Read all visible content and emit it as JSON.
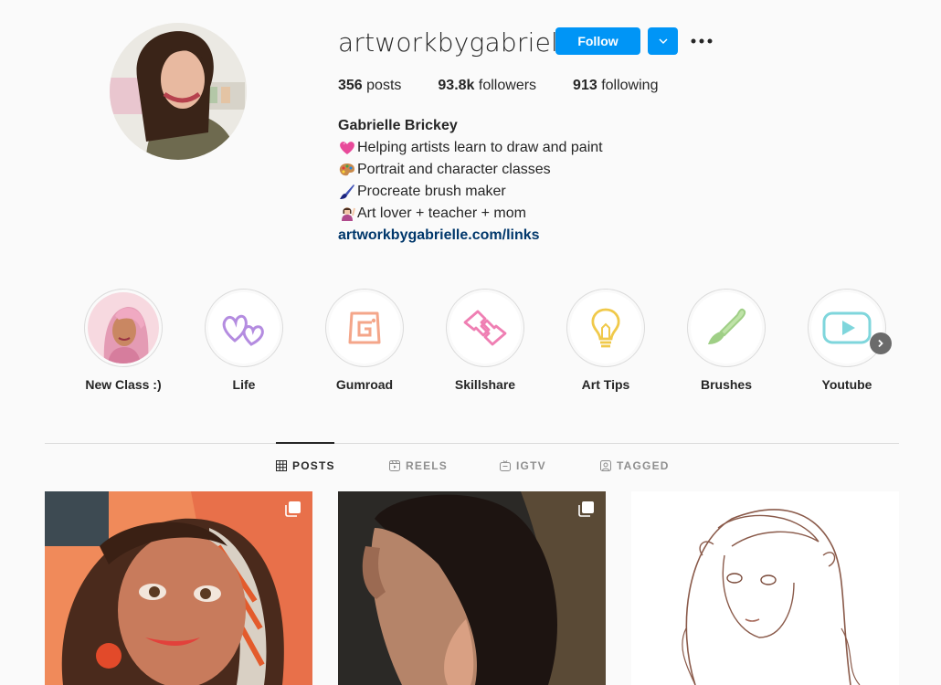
{
  "profile": {
    "username": "artworkbygabrielle",
    "follow_label": "Follow",
    "stats": {
      "posts_count": "356",
      "posts_label": "posts",
      "followers_count": "93.8k",
      "followers_label": "followers",
      "following_count": "913",
      "following_label": "following"
    },
    "full_name": "Gabrielle Brickey",
    "bio_lines": [
      "Helping artists learn to draw and paint",
      "Portrait and character classes",
      "Procreate brush maker",
      "Art lover + teacher + mom"
    ],
    "link": "artworkbygabrielle.com/links"
  },
  "highlights": [
    {
      "label": "New Class :)",
      "icon": "woman-portrait"
    },
    {
      "label": "Life",
      "icon": "hearts-icon"
    },
    {
      "label": "Gumroad",
      "icon": "gumroad-g-icon"
    },
    {
      "label": "Skillshare",
      "icon": "hands-icon"
    },
    {
      "label": "Art Tips",
      "icon": "lightbulb-icon"
    },
    {
      "label": "Brushes",
      "icon": "brush-icon"
    },
    {
      "label": "Youtube",
      "icon": "youtube-play-icon"
    }
  ],
  "tabs": [
    {
      "label": "POSTS",
      "icon": "grid-icon",
      "active": true
    },
    {
      "label": "REELS",
      "icon": "reels-icon",
      "active": false
    },
    {
      "label": "IGTV",
      "icon": "igtv-icon",
      "active": false
    },
    {
      "label": "TAGGED",
      "icon": "tagged-icon",
      "active": false
    }
  ],
  "colors": {
    "accent": "#0095f6",
    "link": "#00376b",
    "background": "#fafafa"
  }
}
